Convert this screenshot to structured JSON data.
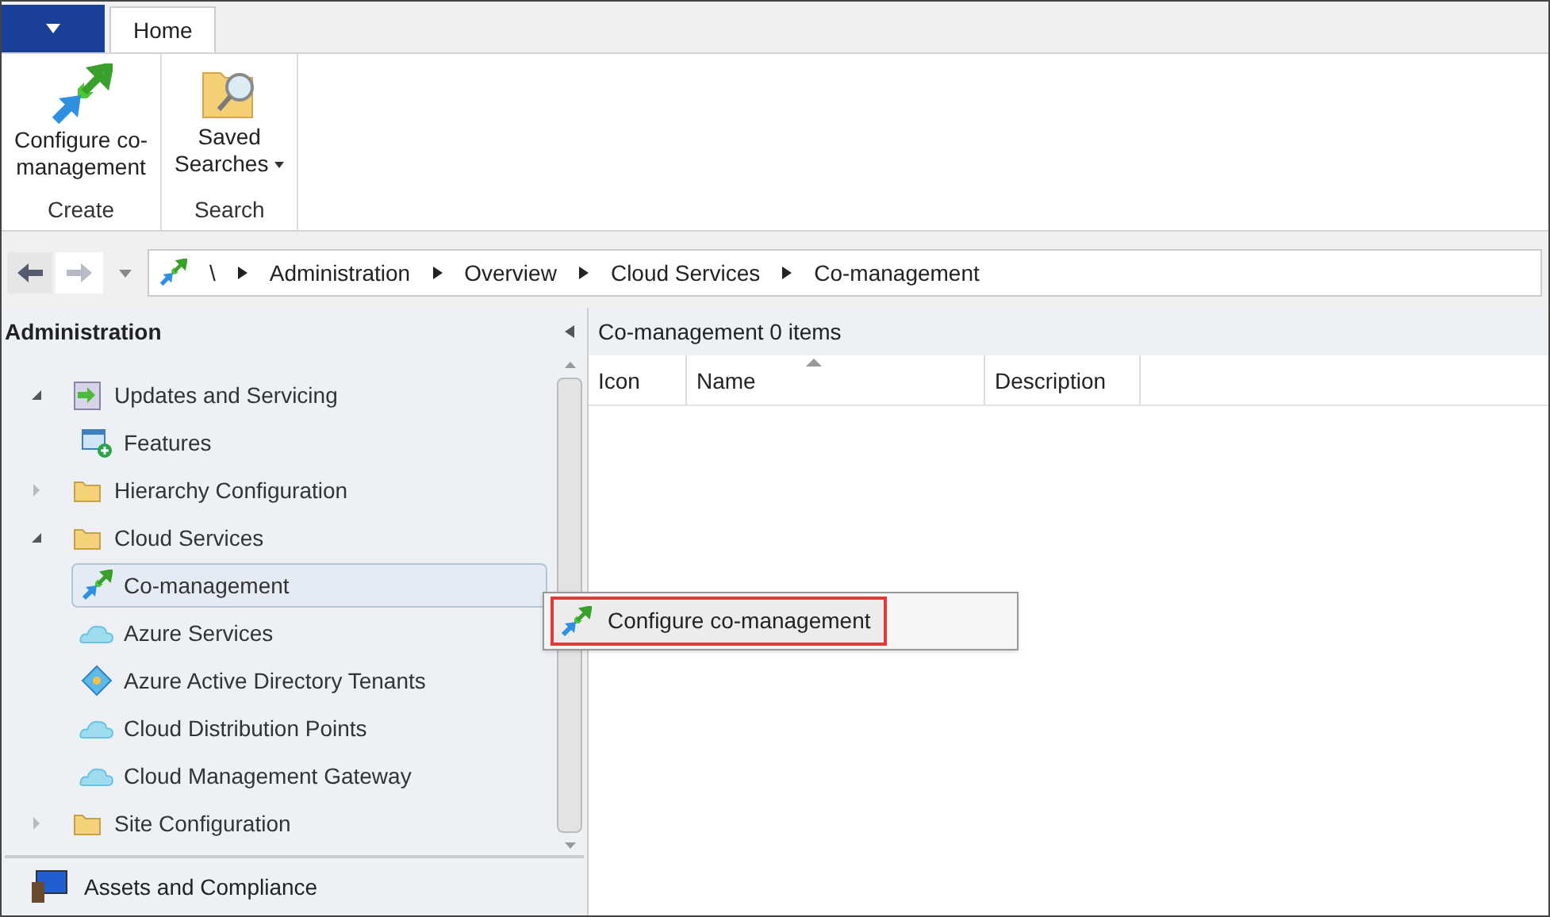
{
  "ribbon": {
    "tabs": [
      {
        "label": "Home",
        "selected": true
      }
    ],
    "groups": [
      {
        "label": "Create",
        "buttons": [
          {
            "kind": "comanage",
            "lines": [
              "Configure co-",
              "management"
            ],
            "dropdown": false
          }
        ]
      },
      {
        "label": "Search",
        "buttons": [
          {
            "kind": "saved",
            "lines": [
              "Saved",
              "Searches"
            ],
            "dropdown": true
          }
        ]
      }
    ]
  },
  "nav": {
    "path": [
      "\\",
      "Administration",
      "Overview",
      "Cloud Services",
      "Co-management"
    ]
  },
  "left_pane": {
    "title": "Administration",
    "tree": [
      {
        "label": "Updates and Servicing",
        "kind": "updates",
        "expanded": true,
        "selected": false,
        "children": [
          {
            "label": "Features",
            "kind": "features",
            "selected": false
          }
        ]
      },
      {
        "label": "Hierarchy Configuration",
        "kind": "folder",
        "expanded": false,
        "selected": false
      },
      {
        "label": "Cloud Services",
        "kind": "folder",
        "expanded": true,
        "selected": false,
        "children": [
          {
            "label": "Co-management",
            "kind": "comanage",
            "selected": true
          },
          {
            "label": "Azure Services",
            "kind": "cloud",
            "selected": false
          },
          {
            "label": "Azure Active Directory Tenants",
            "kind": "diamond",
            "selected": false
          },
          {
            "label": "Cloud Distribution Points",
            "kind": "cloud",
            "selected": false
          },
          {
            "label": "Cloud Management Gateway",
            "kind": "cloud",
            "selected": false
          }
        ]
      },
      {
        "label": "Site Configuration",
        "kind": "folder",
        "expanded": false,
        "selected": false
      }
    ],
    "workspace": {
      "label": "Assets and Compliance"
    }
  },
  "list": {
    "title": "Co-management",
    "count": "0 items",
    "columns": [
      {
        "label": "Icon",
        "sorted": false
      },
      {
        "label": "Name",
        "sorted": true
      },
      {
        "label": "Description",
        "sorted": false
      }
    ]
  },
  "context_menu": {
    "items": [
      {
        "label": "Configure co-management",
        "kind": "comanage",
        "highlighted": true
      }
    ]
  }
}
